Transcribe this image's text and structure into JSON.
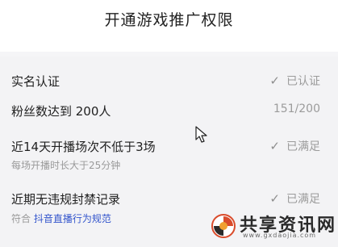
{
  "header": {
    "title": "开通游戏推广权限"
  },
  "requirements": [
    {
      "label": "实名认证",
      "status": "已认证",
      "check": true
    },
    {
      "label": "粉丝数达到 200人",
      "status": "151/200",
      "check": false
    },
    {
      "label": "近14天开播场次不低于3场",
      "sub": "每场开播时长大于25分钟",
      "status": "已满足",
      "check": true
    },
    {
      "label": "近期无违规封禁记录",
      "sub_prefix": "符合",
      "sub_link": "抖音直播行为规范",
      "status": "已满足",
      "check": true
    }
  ],
  "watermark": {
    "text": "共享资讯网",
    "url": "www.gxdaojia.com"
  }
}
